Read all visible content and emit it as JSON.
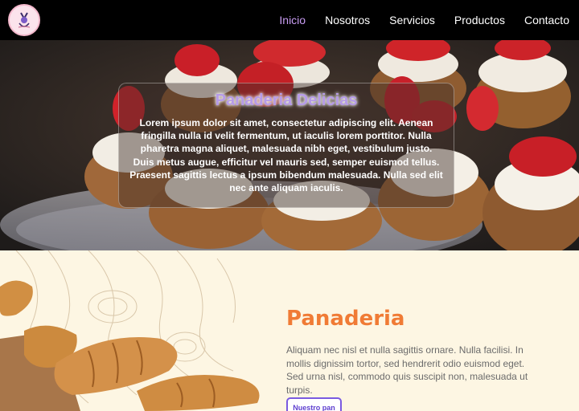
{
  "nav": {
    "logo_icon": "bakery-logo-icon",
    "links": [
      {
        "label": "Inicio",
        "active": true
      },
      {
        "label": "Nosotros",
        "active": false
      },
      {
        "label": "Servicios",
        "active": false
      },
      {
        "label": "Productos",
        "active": false
      },
      {
        "label": "Contacto",
        "active": false
      }
    ],
    "active_color": "#c89cf2"
  },
  "hero": {
    "title": "Panaderia Delicias",
    "text": "Lorem ipsum dolor sit amet, consectetur adipiscing elit. Aenean fringilla nulla id velit fermentum, ut iaculis lorem porttitor. Nulla pharetra magna aliquet, malesuada nibh eget, vestibulum justo. Duis metus augue, efficitur vel mauris sed, semper euismod tellus. Praesent sagittis lectus a ipsum bibendum malesuada. Nulla sed elit nec ante aliquam iaculis."
  },
  "section": {
    "title": "Panaderia",
    "text": "Aliquam nec nisl et nulla sagittis ornare. Nulla facilisi. In mollis dignissim tortor, sed hendrerit odio euismod eget. Sed urna nisl, commodo quis suscipit non, malesuada ut turpis.",
    "button_label": "Nuestro pan",
    "title_color": "#f07b35",
    "button_color": "#7a5ae0"
  }
}
